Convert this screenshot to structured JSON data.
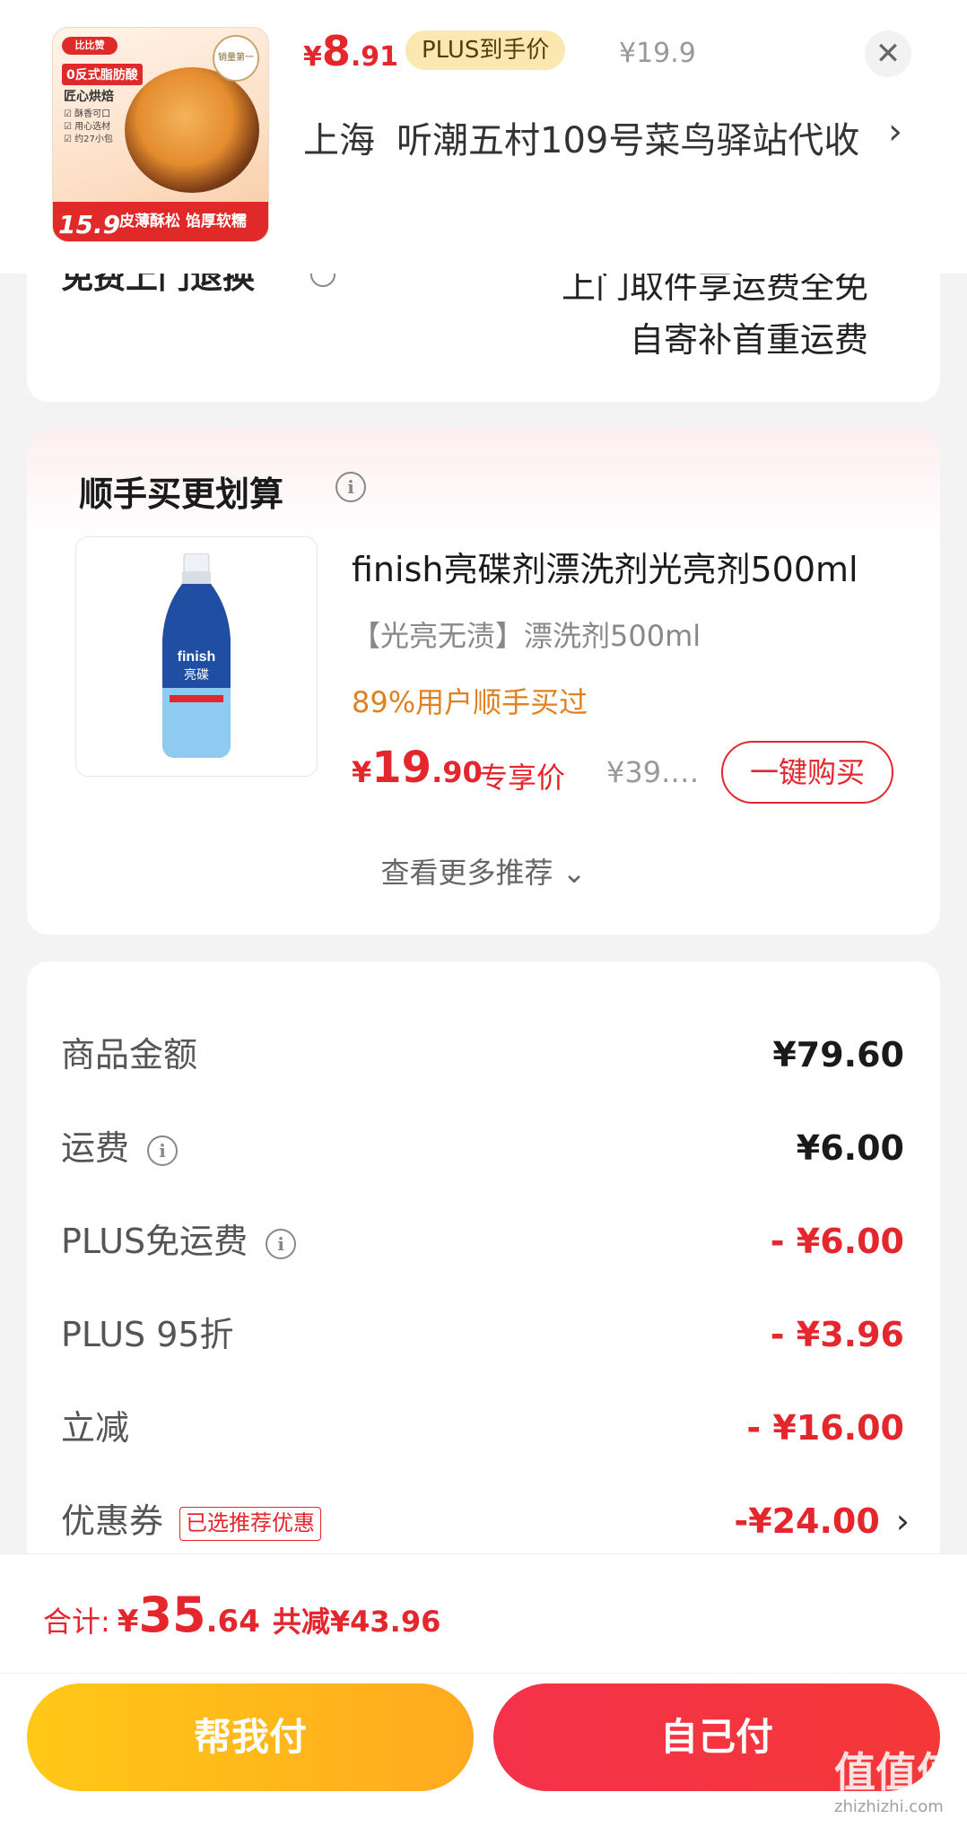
{
  "header": {
    "thumb": {
      "brand": "比比赞",
      "tag1": "0反式脂肪酸",
      "tag2": "匠心烘焙",
      "ticks": [
        "☑ 酥香可口",
        "☑ 用心选材",
        "☑ 约27小包"
      ],
      "badge": "销量第一",
      "bottom_price": "15.9",
      "bottom_text": "皮薄酥松 馅厚软糯"
    },
    "price": {
      "currency": "¥",
      "int": "8",
      "dec": ".91"
    },
    "plus_label": "PLUS到手价",
    "orig_price": "¥19.9",
    "close_glyph": "✕",
    "address": {
      "city": "上海",
      "detail": "听潮五村109号菜鸟驿站代收",
      "chevron": "›"
    }
  },
  "service": {
    "title_cut": "免费上门退换",
    "line1": "上门取件享运费全免",
    "line2": "自寄补首重运费"
  },
  "recommend": {
    "title": "顺手买更划算",
    "info_glyph": "i",
    "product": {
      "name": "finish亮碟剂漂洗剂光亮剂500ml",
      "spec": "【光亮无渍】漂洗剂500ml",
      "pct_bought": "89%用户顺手买过",
      "price": {
        "currency": "¥",
        "int": "19",
        "dec": ".90"
      },
      "exclusive": "专享价",
      "orig": "¥39.…",
      "buy_button": "一键购买",
      "bottle_brand": "finish",
      "bottle_sub": "亮碟"
    },
    "more": "查看更多推荐 ⌄"
  },
  "summary": {
    "rows": [
      {
        "label": "商品金额",
        "value": "¥79.60"
      },
      {
        "label": "运费",
        "value": "¥6.00"
      },
      {
        "label": "PLUS免运费",
        "value": "- ¥6.00"
      },
      {
        "label": "PLUS 95折",
        "value": "- ¥3.96"
      },
      {
        "label": "立减",
        "value": "- ¥16.00"
      },
      {
        "label": "优惠券",
        "value": "-¥24.00",
        "tag": "已选推荐优惠",
        "chevron": "›"
      }
    ]
  },
  "footer": {
    "total_label": "合计:",
    "total": {
      "currency": "¥",
      "int": "35",
      "dec": ".64"
    },
    "saved": "共减¥43.96",
    "help_pay": "帮我付",
    "self_pay": "自己付"
  },
  "watermark": {
    "main": "值值值",
    "sub": "zhizhizhi.com"
  },
  "colors": {
    "accent_red": "#e4262d",
    "plus_gold": "#fbe8b0",
    "help_yellow": "#ffbb1a",
    "orange_text": "#e0801f"
  }
}
